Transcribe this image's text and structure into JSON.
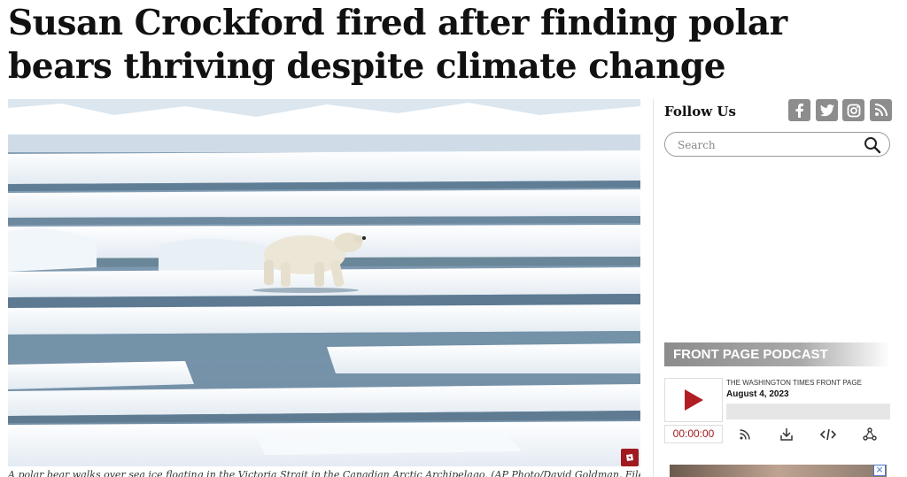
{
  "article": {
    "headline": "Susan Crockford fired after finding polar bears thriving despite climate change",
    "caption": "A polar bear walks over sea ice floating in the Victoria Strait in the Canadian Arctic Archipelago. (AP Photo/David Goldman, File)"
  },
  "sidebar": {
    "follow_label": "Follow Us",
    "social_icons": [
      "facebook-icon",
      "twitter-icon",
      "instagram-icon",
      "rss-icon"
    ],
    "search": {
      "placeholder": "Search"
    }
  },
  "podcast": {
    "header": "FRONT PAGE PODCAST",
    "show_title": "THE WASHINGTON TIMES FRONT PAGE",
    "date": "August 4, 2023",
    "current_time": "00:00:00",
    "progress": 0,
    "controls": [
      "subscribe-icon",
      "download-icon",
      "embed-icon",
      "share-icon"
    ]
  },
  "ad": {
    "close_label": "×"
  },
  "colors": {
    "accent": "#a01a20",
    "social_gray": "#8d8d8d",
    "podcast_header": "#9a9a9a"
  }
}
